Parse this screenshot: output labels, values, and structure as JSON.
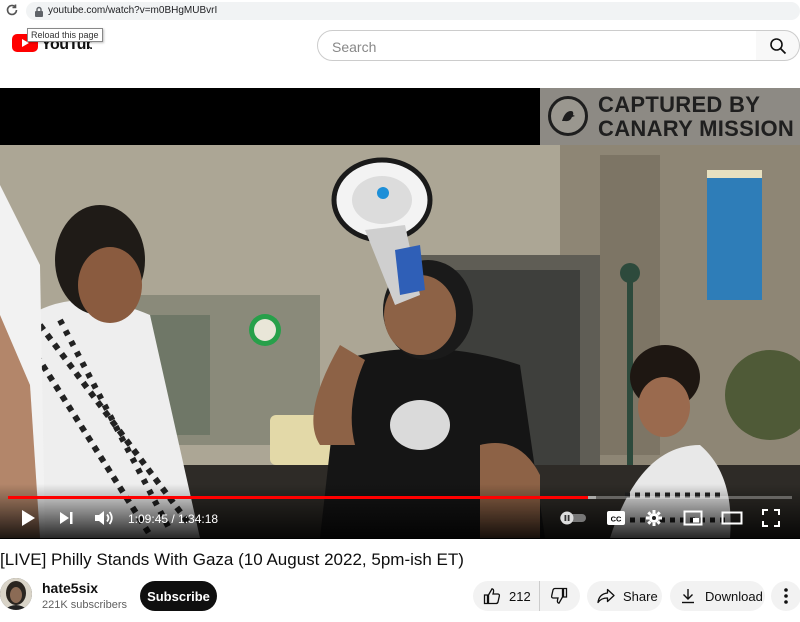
{
  "browser": {
    "url": "youtube.com/watch?v=m0BHgMUBvrI",
    "reload_tooltip": "Reload this page"
  },
  "header": {
    "logo_text": "YouTube",
    "search_placeholder": "Search"
  },
  "player": {
    "watermark_line1": "CAPTURED BY",
    "watermark_line2": "CANARY MISSION",
    "current_time": "1:09:45",
    "duration": "1:34:18",
    "time_display": "1:09:45 / 1:34:18",
    "progress_fraction": 0.74,
    "buffered_fraction": 0.75,
    "autoplay": "off",
    "icons": [
      "play-icon",
      "next-icon",
      "volume-icon",
      "autoplay-toggle-icon",
      "captions-icon",
      "settings-icon",
      "miniplayer-icon",
      "theater-icon",
      "fullscreen-icon"
    ],
    "accent_color": "#ff0000"
  },
  "video": {
    "title": "[LIVE] Philly Stands With Gaza (10 August 2022, 5pm-ish ET)",
    "channel_name": "hate5six",
    "subscribers": "221K subscribers",
    "subscribe_label": "Subscribe",
    "like_count": "212",
    "share_label": "Share",
    "download_label": "Download"
  }
}
